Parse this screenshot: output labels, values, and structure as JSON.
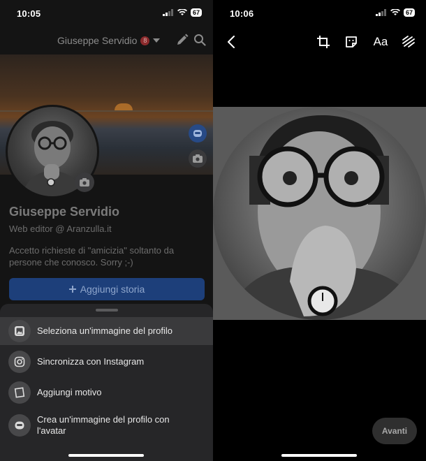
{
  "left": {
    "status": {
      "time": "10:05",
      "battery": "67"
    },
    "header": {
      "name": "Giuseppe Servidio",
      "badge": "8"
    },
    "profile": {
      "name": "Giuseppe Servidio",
      "job": "Web editor @ Aranzulla.it",
      "bio": "Accetto richieste di \"amicizia\" soltanto da persone che conosco. Sorry ;-)",
      "story_button": "Aggiungi storia"
    },
    "sheet": {
      "items": [
        {
          "label": "Seleziona un'immagine del profilo",
          "icon": "image-icon"
        },
        {
          "label": "Sincronizza con Instagram",
          "icon": "instagram-icon"
        },
        {
          "label": "Aggiungi motivo",
          "icon": "frame-icon"
        },
        {
          "label": "Crea un'immagine del profilo con l'avatar",
          "icon": "avatar-icon"
        }
      ]
    }
  },
  "right": {
    "status": {
      "time": "10:06",
      "battery": "67"
    },
    "toolbar": {
      "text_tool": "Aa"
    },
    "next_button": "Avanti"
  },
  "colors": {
    "accent_blue": "#1877f2",
    "sheet_bg": "#262628",
    "badge_red": "#e41e3f"
  }
}
